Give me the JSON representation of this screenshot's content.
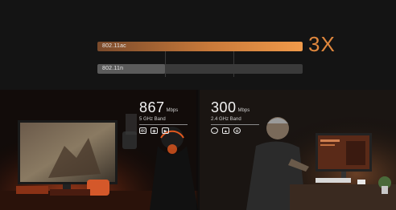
{
  "comparison": {
    "multiplier": "3X",
    "bars": [
      {
        "label": "802.11ac",
        "value": 1.0,
        "color": "#e8893c"
      },
      {
        "label": "802.11n",
        "value": 0.33,
        "color": "#5b5b5b"
      }
    ]
  },
  "stats": [
    {
      "value": "867",
      "unit": "Mbps",
      "band": "5 GHz Band",
      "icons": [
        "4k-video-icon",
        "gamepad-icon",
        "play-icon"
      ]
    },
    {
      "value": "300",
      "unit": "Mbps",
      "band": "2.4 GHz Band",
      "icons": [
        "chat-icon",
        "image-icon",
        "globe-icon"
      ]
    }
  ]
}
